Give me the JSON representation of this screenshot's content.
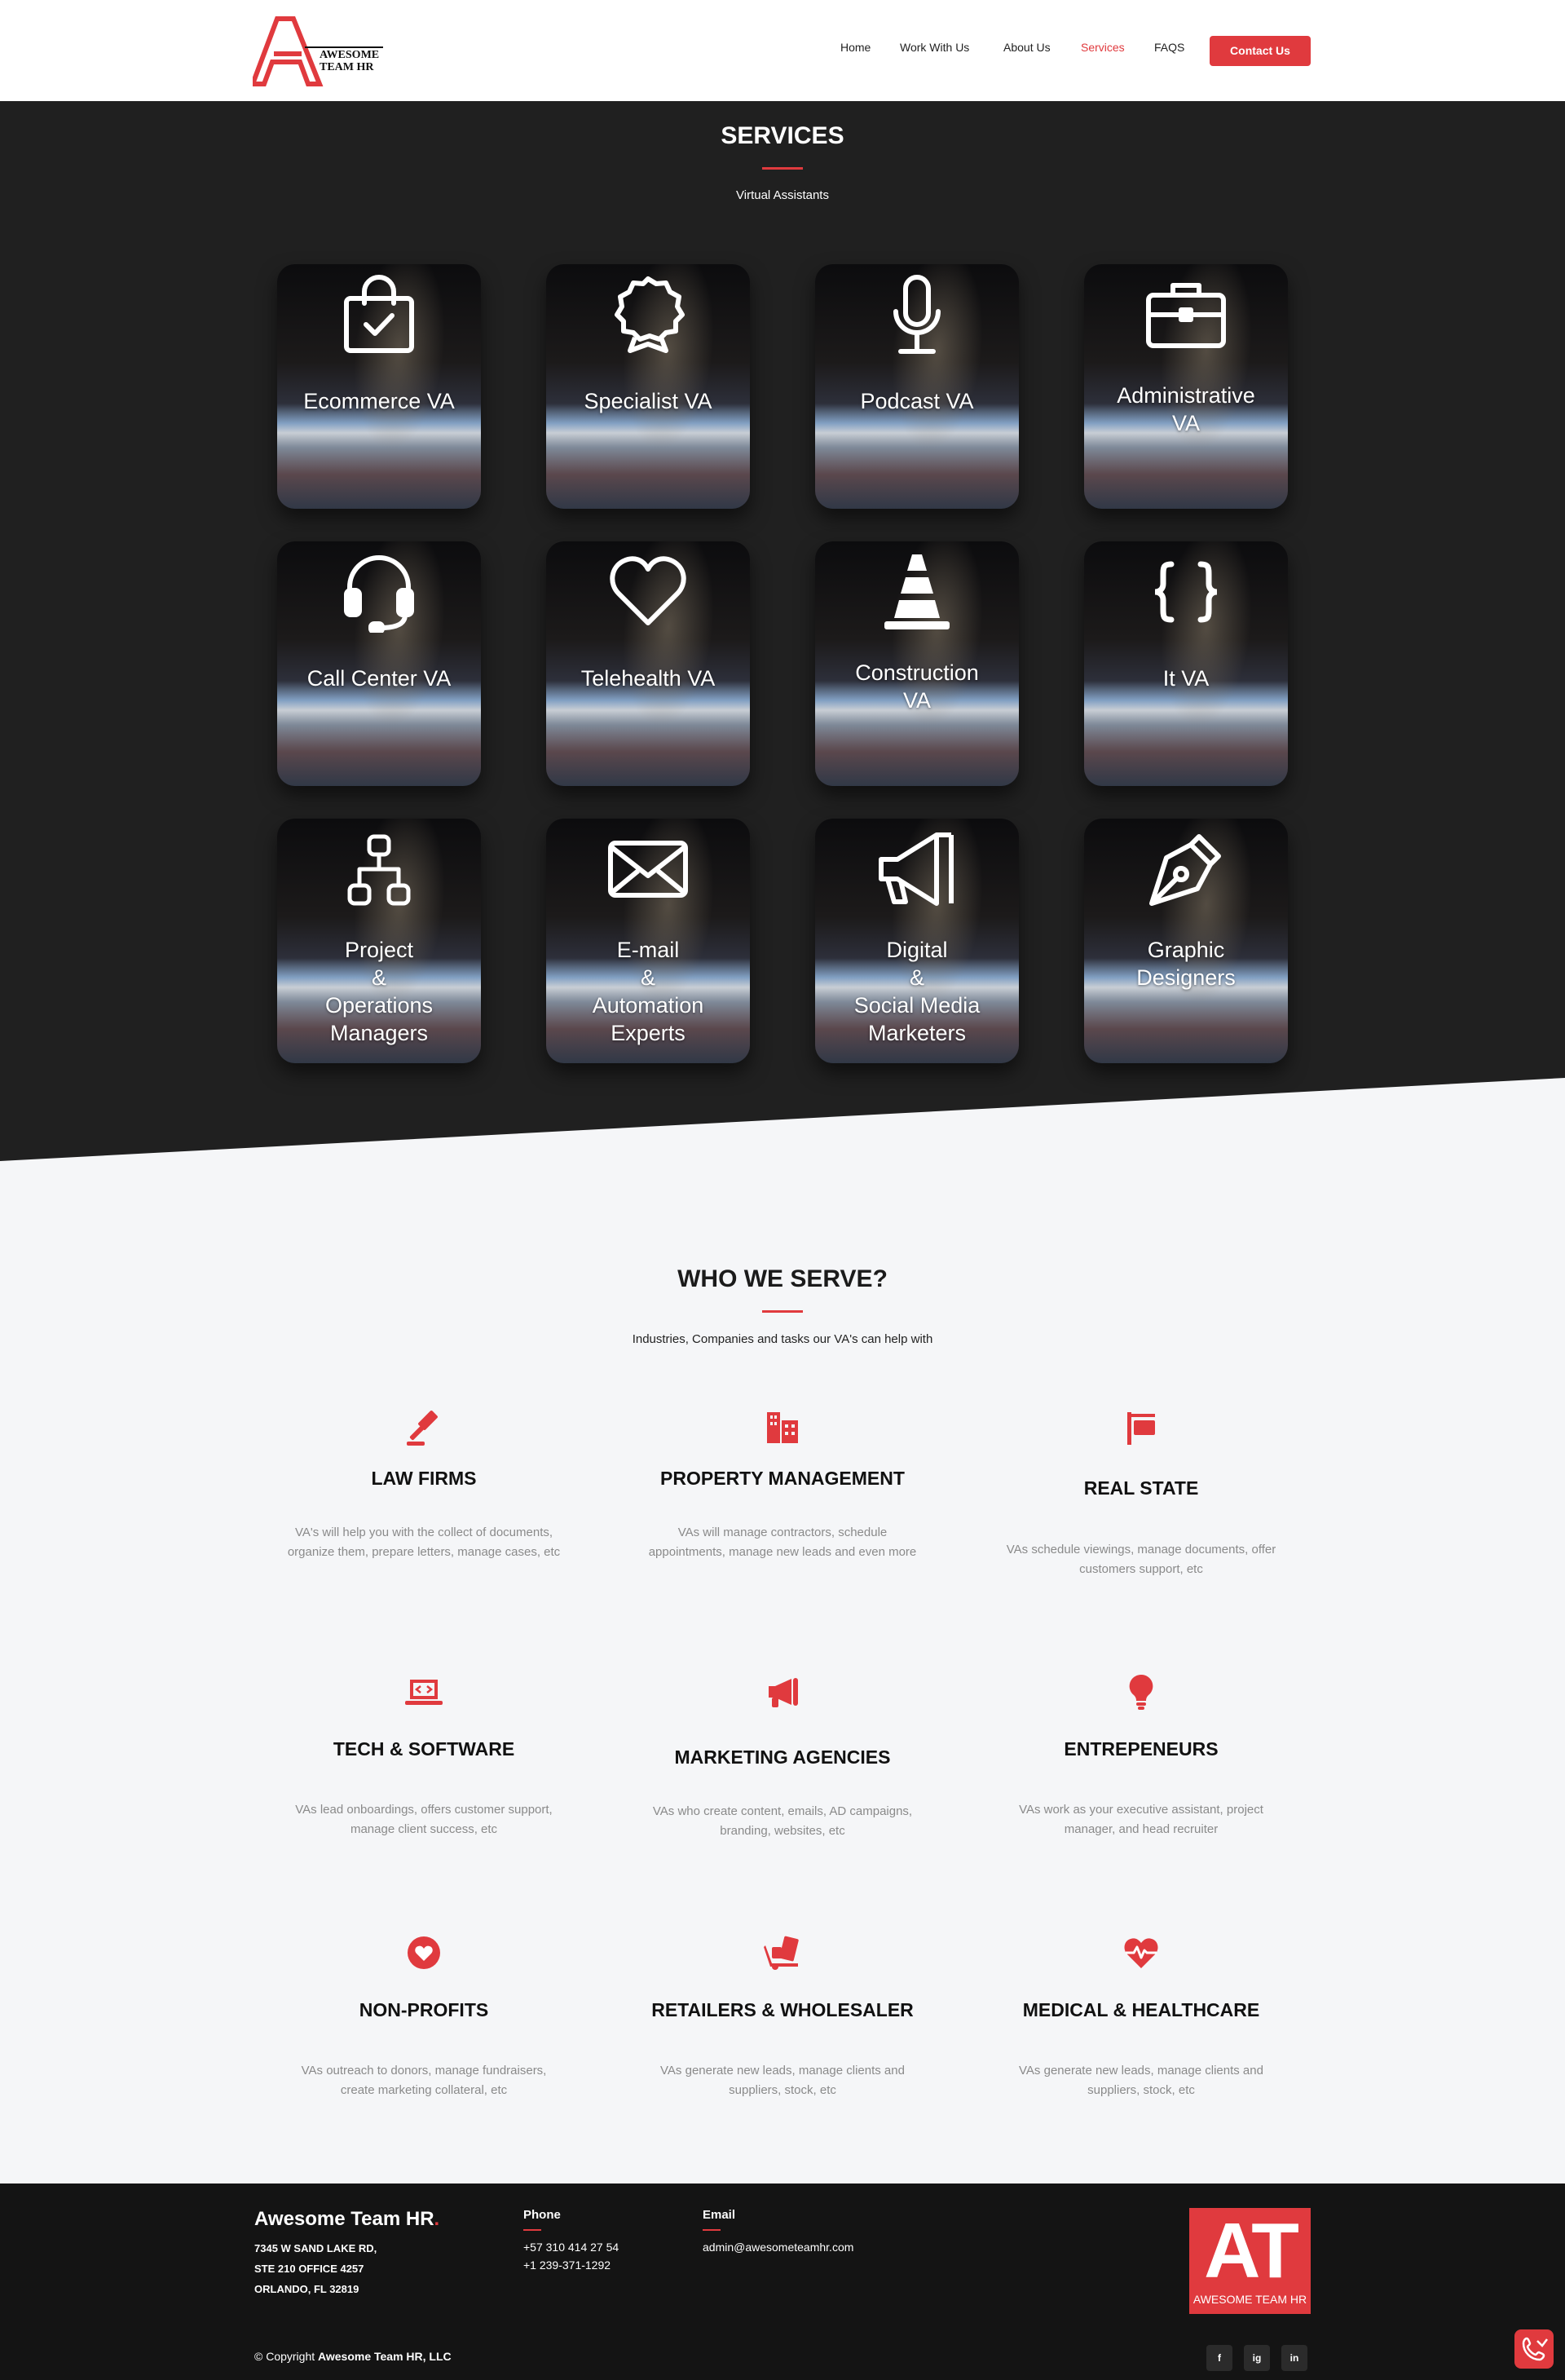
{
  "header": {
    "logo_line1": "AWESOME",
    "logo_line2": "TEAM HR",
    "nav": [
      {
        "label": "Home"
      },
      {
        "label": "Work With Us"
      },
      {
        "label": "About Us"
      },
      {
        "label": "Services",
        "active": true
      },
      {
        "label": "FAQS"
      }
    ],
    "contact_label": "Contact Us"
  },
  "services": {
    "title": "SERVICES",
    "subtitle": "Virtual Assistants",
    "cards": [
      {
        "label": "Ecommerce VA",
        "icon": "shopping-bag-check-icon"
      },
      {
        "label": "Specialist VA",
        "icon": "award-ribbon-icon"
      },
      {
        "label": "Podcast VA",
        "icon": "microphone-icon"
      },
      {
        "label": "Administrative\nVA",
        "icon": "briefcase-icon"
      },
      {
        "label": "Call Center VA",
        "icon": "headset-icon"
      },
      {
        "label": "Telehealth VA",
        "icon": "heart-icon"
      },
      {
        "label": "Construction\nVA",
        "icon": "traffic-cone-icon"
      },
      {
        "label": "It VA",
        "icon": "curly-braces-icon"
      },
      {
        "label": "Project\n&\nOperations\nManagers",
        "icon": "sitemap-icon"
      },
      {
        "label": "E-mail\n&\nAutomation\nExperts",
        "icon": "envelope-icon"
      },
      {
        "label": "Digital\n&\nSocial Media\nMarketers",
        "icon": "megaphone-icon"
      },
      {
        "label": "Graphic\nDesigners",
        "icon": "pen-nib-icon"
      }
    ]
  },
  "who": {
    "title": "WHO WE SERVE?",
    "subtitle": "Industries, Companies and tasks our VA's can help with",
    "items": [
      {
        "title": "LAW FIRMS",
        "desc": "VA's will help you with the collect of documents, organize them, prepare letters, manage cases, etc",
        "icon": "gavel-icon"
      },
      {
        "title": "PROPERTY MANAGEMENT",
        "desc": "VAs will manage contractors, schedule appointments, manage new leads and even more",
        "icon": "buildings-icon"
      },
      {
        "title": "REAL STATE",
        "desc": "VAs schedule viewings, manage documents, offer customers support, etc",
        "icon": "real-estate-sign-icon"
      },
      {
        "title": "TECH & SOFTWARE",
        "desc": "VAs lead onboardings, offers customer support, manage client success, etc",
        "icon": "laptop-code-icon"
      },
      {
        "title": "MARKETING AGENCIES",
        "desc": "VAs who create content, emails, AD campaigns, branding, websites, etc",
        "icon": "bullhorn-icon"
      },
      {
        "title": "ENTREPENEURS",
        "desc": "VAs work as your executive assistant, project manager, and head recruiter",
        "icon": "lightbulb-icon"
      },
      {
        "title": "NON-PROFITS",
        "desc": "VAs outreach to donors, manage fundraisers, create marketing collateral, etc",
        "icon": "heart-circle-icon"
      },
      {
        "title": "RETAILERS & WHOLESALER",
        "desc": "VAs generate new leads, manage clients and suppliers, stock, etc",
        "icon": "dolly-icon"
      },
      {
        "title": "MEDICAL & HEALTHCARE",
        "desc": "VAs generate new leads, manage clients and suppliers, stock, etc",
        "icon": "heartbeat-icon"
      }
    ]
  },
  "footer": {
    "brand": "Awesome Team HR",
    "brand_dot": ".",
    "address": [
      "7345 W SAND LAKE RD,",
      "STE 210 OFFICE 4257",
      "ORLANDO, FL 32819"
    ],
    "phone_heading": "Phone",
    "phones": [
      "+57 310 414 27 54",
      "+1 239-371-1292"
    ],
    "email_heading": "Email",
    "email": "admin@awesometeamhr.com",
    "logo_letters": "AT",
    "logo_sub": "AWESOME TEAM HR",
    "copyright_prefix": "© Copyright",
    "copyright_name": "Awesome Team HR, LLC",
    "social": [
      "f",
      "ig",
      "in"
    ]
  },
  "colors": {
    "accent": "#e03a3e",
    "dark": "#202020",
    "footer": "#141414",
    "light_bg": "#f5f6f8"
  }
}
